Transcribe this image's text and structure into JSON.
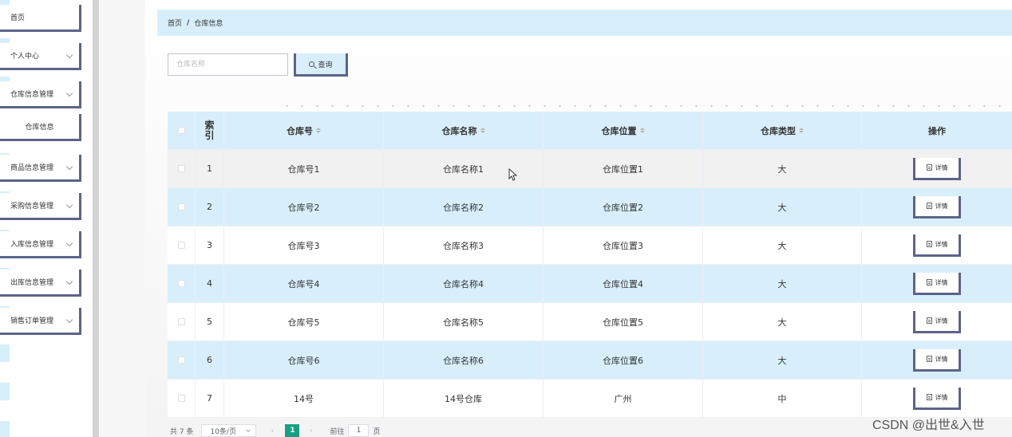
{
  "sidebar": {
    "items": [
      {
        "label": "首页",
        "has_chevron": false
      },
      {
        "label": "个人中心",
        "has_chevron": true
      },
      {
        "label": "仓库信息管理",
        "has_chevron": true
      },
      {
        "label": "仓库信息",
        "has_chevron": false
      },
      {
        "label": "商品信息管理",
        "has_chevron": true
      },
      {
        "label": "采购信息管理",
        "has_chevron": true
      },
      {
        "label": "入库信息管理",
        "has_chevron": true
      },
      {
        "label": "出库信息管理",
        "has_chevron": true
      },
      {
        "label": "销售订单管理",
        "has_chevron": true
      }
    ]
  },
  "breadcrumb": {
    "home": "首页",
    "separator": "/",
    "current": "仓库信息"
  },
  "search": {
    "placeholder": "仓库名称",
    "button_label": "查询"
  },
  "table": {
    "columns": [
      "索引",
      "仓库号",
      "仓库名称",
      "仓库位置",
      "仓库类型",
      "操作"
    ],
    "rows": [
      {
        "index": "1",
        "no": "仓库号1",
        "name": "仓库名称1",
        "location": "仓库位置1",
        "type": "大"
      },
      {
        "index": "2",
        "no": "仓库号2",
        "name": "仓库名称2",
        "location": "仓库位置2",
        "type": "大"
      },
      {
        "index": "3",
        "no": "仓库号3",
        "name": "仓库名称3",
        "location": "仓库位置3",
        "type": "大"
      },
      {
        "index": "4",
        "no": "仓库号4",
        "name": "仓库名称4",
        "location": "仓库位置4",
        "type": "大"
      },
      {
        "index": "5",
        "no": "仓库号5",
        "name": "仓库名称5",
        "location": "仓库位置5",
        "type": "大"
      },
      {
        "index": "6",
        "no": "仓库号6",
        "name": "仓库名称6",
        "location": "仓库位置6",
        "type": "大"
      },
      {
        "index": "7",
        "no": "14号",
        "name": "14号仓库",
        "location": "广州",
        "type": "中"
      }
    ],
    "detail_label": "详情"
  },
  "pagination": {
    "total": "共 7 条",
    "page_size": "10条/页",
    "prev": "‹",
    "current_page": "1",
    "next": "›",
    "goto_prefix": "前往",
    "goto_value": "1",
    "goto_suffix": "页"
  },
  "watermark": "CSDN @出世&入世",
  "colors": {
    "accent": "#d8effb",
    "border_dark": "#5c6488",
    "page_active": "#16a085"
  }
}
